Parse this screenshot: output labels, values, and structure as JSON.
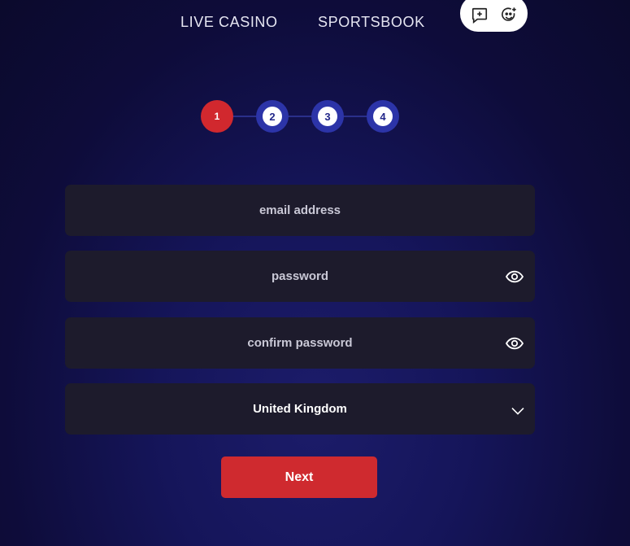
{
  "nav": {
    "links": [
      "LIVE CASINO",
      "SPORTSBOOK"
    ]
  },
  "floating_actions": {
    "icons": [
      "add-comment-icon",
      "add-emoji-icon"
    ]
  },
  "stepper": {
    "steps": [
      "1",
      "2",
      "3",
      "4"
    ],
    "current_step": "1",
    "colors": {
      "active": "#d1282e",
      "pending": "#2c34a8"
    }
  },
  "form": {
    "email": {
      "placeholder": "email address",
      "value": ""
    },
    "password": {
      "placeholder": "password",
      "value": "",
      "icon": "eye-icon"
    },
    "confirm_password": {
      "placeholder": "confirm password",
      "value": "",
      "icon": "eye-icon"
    },
    "country": {
      "value": "United Kingdom",
      "icon": "chevron-down-icon"
    },
    "submit_label": "Next"
  },
  "colors": {
    "field_bg": "#1d1b2c",
    "button_bg": "#cf2a2f",
    "page_bg": "#12124a"
  }
}
